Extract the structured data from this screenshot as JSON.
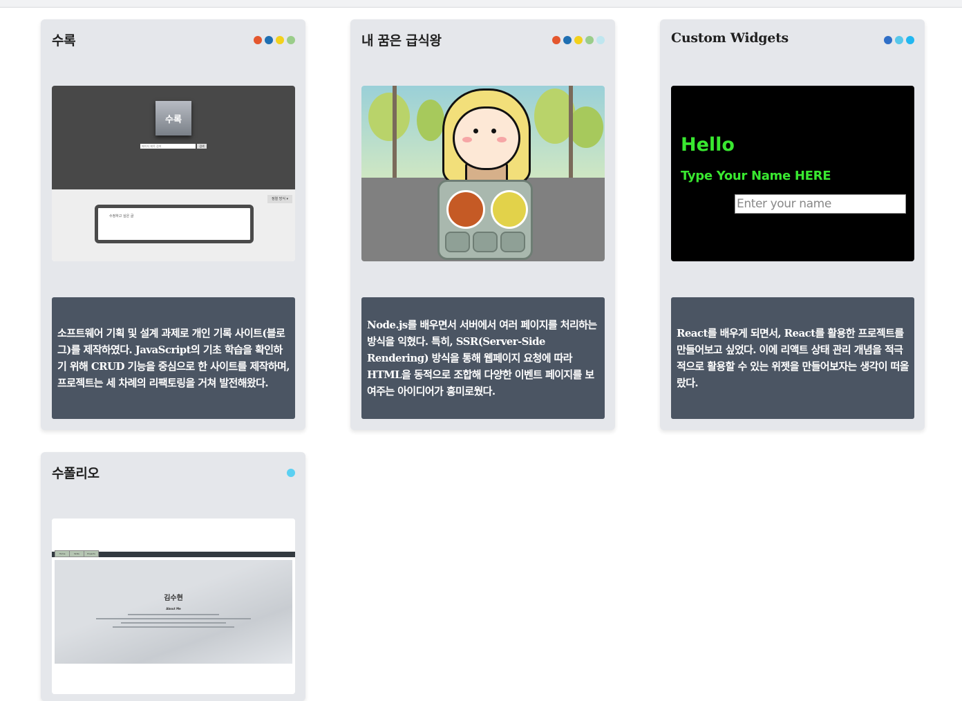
{
  "cards": [
    {
      "title": "수록",
      "dots": [
        "#e4572e",
        "#1f6fb2",
        "#f3d11b",
        "#9acd8a"
      ],
      "description": "소프트웨어 기획 및 설계 과제로 개인 기록 사이트(블로그)를 제작하였다. JavaScript의 기초 학습을 확인하기 위해 CRUD 기능을 중심으로 한 사이트를 제작하며, 프로젝트는 세 차례의 리팩토링을 거쳐 발전해왔다.",
      "thumb": {
        "logo": "수록",
        "search_placeholder": "페이지 제목 검색",
        "search_button": "검색",
        "sort_label": "정렬 방식 ▾",
        "post_placeholder": "수정하고 싶은 글"
      }
    },
    {
      "title": "내 꿈은 급식왕",
      "dots": [
        "#e4572e",
        "#1f6fb2",
        "#f3d11b",
        "#9acd8a",
        "#bfe6ef"
      ],
      "description": "Node.js를 배우면서 서버에서 여러 페이지를 처리하는 방식을 익혔다. 특히, SSR(Server-Side Rendering) 방식을 통해 웹페이지 요청에 따라 HTML을 동적으로 조합해 다양한 이벤트 페이지를 보여주는 아이디어가 흥미로웠다."
    },
    {
      "title": "Custom Widgets",
      "dots": [
        "#2f6fc7",
        "#57c7ea",
        "#22b7f0"
      ],
      "description": "React를 배우게 되면서, React를 활용한 프로젝트를 만들어보고 싶었다. 이에 리액트 상태 관리 개념을 적극적으로 활용할 수 있는 위젯을 만들어보자는 생각이 떠올랐다.",
      "thumb": {
        "hello": "Hello",
        "type_prompt": "Type Your Name HERE",
        "input_placeholder": "Enter your name"
      }
    },
    {
      "title": "수폴리오",
      "dots": [
        "#5bd0f2"
      ],
      "thumb": {
        "tabs": [
          "Home",
          "Skills",
          "Projects"
        ],
        "name": "김수현",
        "about": "About Me"
      }
    }
  ]
}
